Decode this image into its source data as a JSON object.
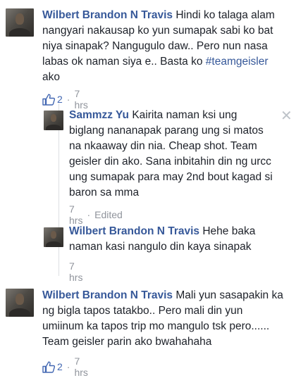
{
  "comments": [
    {
      "author": "Wilbert Brandon N Travis",
      "text_before": " Hindi ko talaga alam\nnangyari nakausap ko yun sumapak sabi ko bat\nniya sinapak? Nangugulo daw.. Pero nun nasa\nlabas ok naman siya e.. Basta ko ",
      "hashtag": "#teamgeisler",
      "text_after": "\nako",
      "likes": "2",
      "separator": "·",
      "time": "7 hrs"
    },
    {
      "author": "Sammzz Yu",
      "text": " Kairita naman ksi ung\nbiglang nananapak parang ung si matos\nna nkaaway din nia. Cheap shot. Team\ngeisler din ako. Sana inbitahin din ng urcc\nung sumapak para may 2nd bout kagad si\nbaron sa mma",
      "time": "7 hrs",
      "separator": "·",
      "edited": "Edited",
      "close": "✕"
    },
    {
      "author": "Wilbert Brandon N Travis",
      "text": " Hehe baka\nnaman kasi nangulo din kaya sinapak",
      "time": "7 hrs"
    },
    {
      "author": "Wilbert Brandon N Travis",
      "text": " Mali yun sasapakin ka\nng bigla tapos tatakbo.. Pero mali din yun\numiinum ka tapos trip mo mangulo tsk pero......\nTeam geisler parin ako bwahahaha",
      "likes": "2",
      "separator": "·",
      "time": "7 hrs"
    }
  ],
  "colors": {
    "link": "#365899",
    "meta": "#90949c",
    "like": "#4267b2"
  },
  "icons": {
    "like": "thumbs-up-icon",
    "close": "close-icon"
  }
}
